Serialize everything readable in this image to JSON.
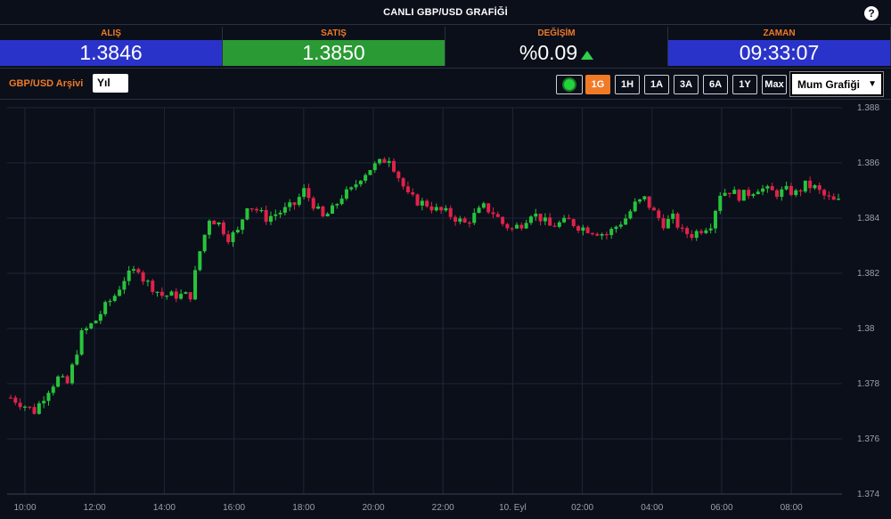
{
  "header": {
    "title": "CANLI GBP/USD GRAFİĞİ",
    "help": "?"
  },
  "quotes": {
    "bid": {
      "label": "ALIŞ",
      "value": "1.3846"
    },
    "ask": {
      "label": "SATIŞ",
      "value": "1.3850"
    },
    "change": {
      "label": "DEĞİŞİM",
      "value": "%0.09"
    },
    "time": {
      "label": "ZAMAN",
      "value": "09:33:07"
    }
  },
  "toolbar": {
    "archive_label": "GBP/USD Arşivi",
    "year_value": "Yıl",
    "ranges": [
      "1G",
      "1H",
      "1A",
      "3A",
      "6A",
      "1Y",
      "Max"
    ],
    "active_range": "1G",
    "chart_type": "Mum Grafiği"
  },
  "colors": {
    "up": "#27c43c",
    "down": "#e0224a",
    "accent": "#f07a26",
    "panel_blue": "#2a33c9",
    "panel_green": "#2a9a34"
  },
  "chart_data": {
    "type": "candlestick",
    "xlabel": "",
    "ylabel": "",
    "ylim": [
      1.374,
      1.388
    ],
    "yticks": [
      1.374,
      1.376,
      1.378,
      1.38,
      1.382,
      1.384,
      1.386,
      1.388
    ],
    "ytick_labels": [
      "1.374",
      "1.376",
      "1.378",
      "1.38",
      "1.382",
      "1.384",
      "1.386",
      "1.388"
    ],
    "xticks": [
      "10:00",
      "12:00",
      "14:00",
      "16:00",
      "18:00",
      "20:00",
      "22:00",
      "10. Eyl",
      "02:00",
      "04:00",
      "06:00",
      "08:00"
    ],
    "grid": true,
    "close_path": [
      [
        0,
        1.3775
      ],
      [
        5,
        1.377
      ],
      [
        8,
        1.3778
      ],
      [
        10,
        1.3782
      ],
      [
        12,
        1.378
      ],
      [
        15,
        1.3798
      ],
      [
        18,
        1.3803
      ],
      [
        20,
        1.3808
      ],
      [
        22,
        1.3812
      ],
      [
        24,
        1.3818
      ],
      [
        27,
        1.3822
      ],
      [
        28,
        1.3818
      ],
      [
        32,
        1.3812
      ],
      [
        35,
        1.3812
      ],
      [
        38,
        1.3812
      ],
      [
        40,
        1.3828
      ],
      [
        42,
        1.384
      ],
      [
        44,
        1.3838
      ],
      [
        46,
        1.3833
      ],
      [
        48,
        1.3835
      ],
      [
        50,
        1.3845
      ],
      [
        52,
        1.3843
      ],
      [
        54,
        1.384
      ],
      [
        58,
        1.3843
      ],
      [
        60,
        1.3845
      ],
      [
        62,
        1.385
      ],
      [
        64,
        1.3845
      ],
      [
        66,
        1.384
      ],
      [
        68,
        1.3843
      ],
      [
        70,
        1.3848
      ],
      [
        72,
        1.385
      ],
      [
        74,
        1.3855
      ],
      [
        76,
        1.3858
      ],
      [
        78,
        1.386
      ],
      [
        80,
        1.3862
      ],
      [
        82,
        1.3855
      ],
      [
        84,
        1.3848
      ],
      [
        86,
        1.3846
      ],
      [
        88,
        1.3845
      ],
      [
        90,
        1.3843
      ],
      [
        92,
        1.3842
      ],
      [
        94,
        1.384
      ],
      [
        96,
        1.3838
      ],
      [
        98,
        1.3841
      ],
      [
        100,
        1.3844
      ],
      [
        102,
        1.3842
      ],
      [
        104,
        1.3838
      ],
      [
        106,
        1.3836
      ],
      [
        108,
        1.3838
      ],
      [
        110,
        1.3842
      ],
      [
        112,
        1.384
      ],
      [
        114,
        1.3837
      ],
      [
        116,
        1.3838
      ],
      [
        118,
        1.3839
      ],
      [
        120,
        1.3837
      ],
      [
        122,
        1.3836
      ],
      [
        124,
        1.3835
      ],
      [
        126,
        1.3834
      ],
      [
        128,
        1.3837
      ],
      [
        130,
        1.384
      ],
      [
        132,
        1.3845
      ],
      [
        134,
        1.3847
      ],
      [
        136,
        1.3842
      ],
      [
        138,
        1.3838
      ],
      [
        140,
        1.384
      ],
      [
        142,
        1.3835
      ],
      [
        144,
        1.3834
      ],
      [
        146,
        1.3836
      ],
      [
        148,
        1.3838
      ],
      [
        150,
        1.3849
      ],
      [
        152,
        1.385
      ],
      [
        154,
        1.3848
      ],
      [
        156,
        1.3849
      ],
      [
        158,
        1.3851
      ],
      [
        160,
        1.385
      ],
      [
        162,
        1.3849
      ],
      [
        164,
        1.385
      ],
      [
        166,
        1.3849
      ],
      [
        168,
        1.3852
      ],
      [
        170,
        1.3851
      ],
      [
        172,
        1.3848
      ],
      [
        174,
        1.3846
      ],
      [
        176,
        1.3846
      ]
    ],
    "total_candles": 176
  }
}
